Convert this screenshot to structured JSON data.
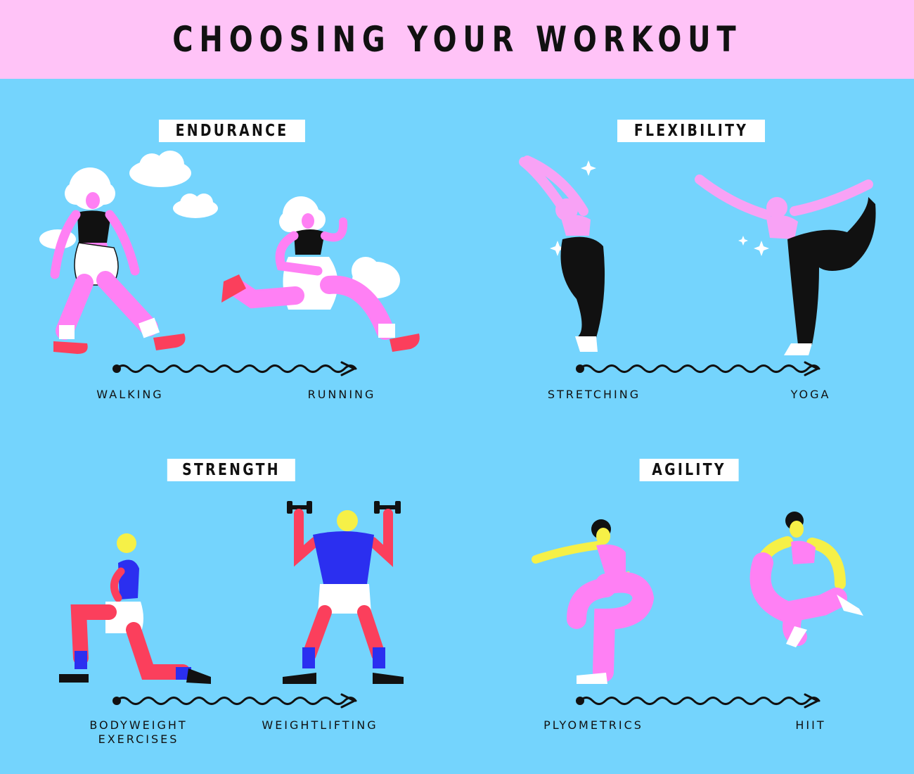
{
  "title": "CHOOSING YOUR WORKOUT",
  "colors": {
    "background": "#74D4FD",
    "header": "#FFC3F7",
    "pink": "#FF80F4",
    "light_pink": "#F8A2F5",
    "yellow": "#F6F047",
    "red": "#FB3F5C",
    "blue": "#2B2FF0",
    "black": "#111111",
    "white": "#FFFFFF"
  },
  "sections": {
    "endurance": {
      "title": "ENDURANCE",
      "start_label": "WALKING",
      "end_label": "RUNNING"
    },
    "flexibility": {
      "title": "FLEXIBILITY",
      "start_label": "STRETCHING",
      "end_label": "YOGA"
    },
    "strength": {
      "title": "STRENGTH",
      "start_label": "BODYWEIGHT\nEXERCISES",
      "end_label": "WEIGHTLIFTING"
    },
    "agility": {
      "title": "AGILITY",
      "start_label": "PLYOMETRICS",
      "end_label": "HIIT"
    }
  }
}
